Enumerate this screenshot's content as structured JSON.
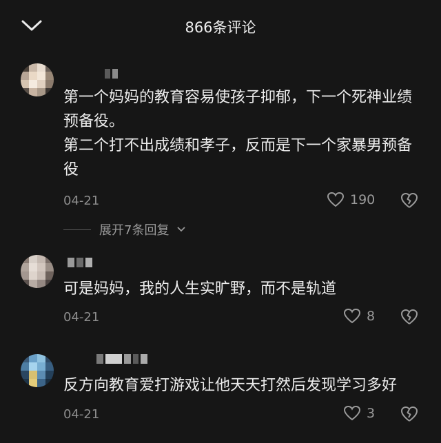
{
  "header": {
    "title": "866条评论",
    "close_icon": "chevron-down-icon"
  },
  "comments": [
    {
      "lines": [
        "第一个妈妈的教育容易使孩子抑郁，下一个死神业绩预备役。",
        "第二个打不出成绩和孝子，反而是下一个家暴男预备役"
      ],
      "date": "04-21",
      "likes": "190",
      "replies": "展开7条回复"
    },
    {
      "lines": [
        "可是妈妈，我的人生实旷野，而不是轨道"
      ],
      "date": "04-21",
      "likes": "8"
    },
    {
      "lines": [
        "反方向教育爱打游戏让他天天打然后发现学习多好"
      ],
      "date": "04-21",
      "likes": "3"
    }
  ]
}
